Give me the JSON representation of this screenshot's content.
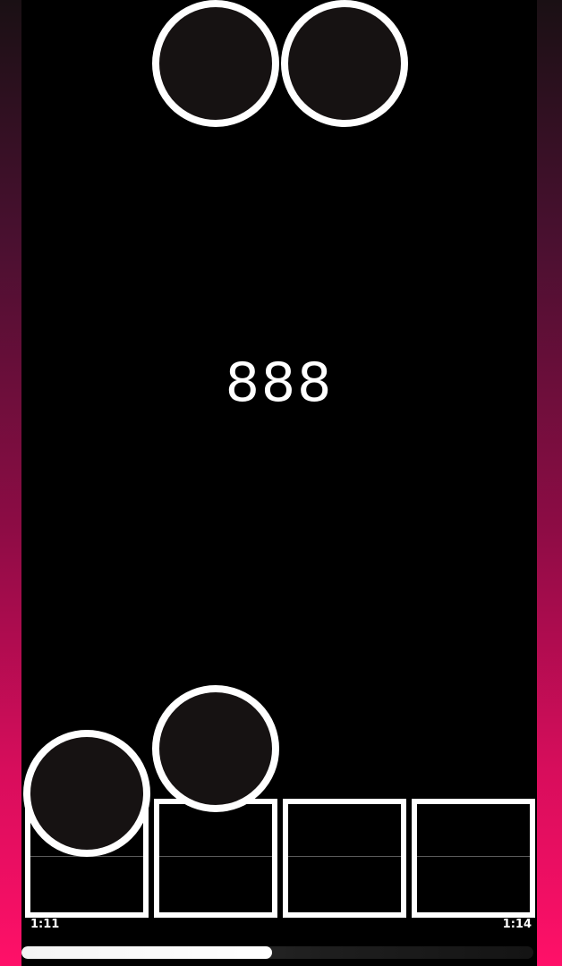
{
  "score": "888",
  "time": {
    "elapsed": "1:11",
    "total": "1:14"
  },
  "progress_fraction": 0.49,
  "lanes": [
    {
      "id": 1
    },
    {
      "id": 2
    },
    {
      "id": 3
    },
    {
      "id": 4
    }
  ],
  "notes": [
    {
      "lane": 2,
      "section": "top"
    },
    {
      "lane": 3,
      "section": "top"
    },
    {
      "lane": 2,
      "section": "approaching"
    },
    {
      "lane": 1,
      "section": "at-target"
    }
  ],
  "colors": {
    "background_gradient_top": "#1a1014",
    "background_gradient_bottom": "#ff1068",
    "playfield": "#000000",
    "note_fill": "#161212",
    "note_outline": "#ffffff",
    "text": "#ffffff"
  }
}
